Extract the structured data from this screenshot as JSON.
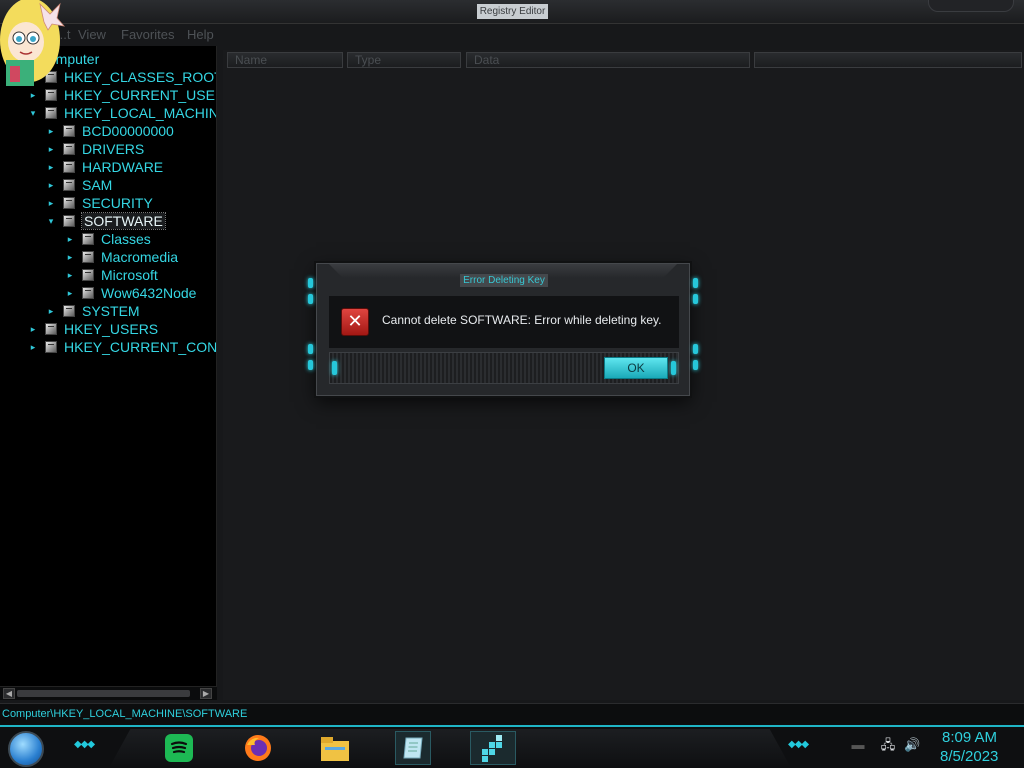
{
  "window": {
    "title": "Registry Editor"
  },
  "menu": {
    "items": [
      "...t",
      "View",
      "Favorites",
      "Help"
    ]
  },
  "tree": {
    "root_label": "...mputer",
    "items": [
      {
        "label": "HKEY_CLASSES_ROOT",
        "level": 1,
        "expanded": false
      },
      {
        "label": "HKEY_CURRENT_USER",
        "level": 1,
        "expanded": false
      },
      {
        "label": "HKEY_LOCAL_MACHINE",
        "level": 1,
        "expanded": true
      },
      {
        "label": "BCD00000000",
        "level": 2,
        "expanded": false
      },
      {
        "label": "DRIVERS",
        "level": 2,
        "expanded": false
      },
      {
        "label": "HARDWARE",
        "level": 2,
        "expanded": false
      },
      {
        "label": "SAM",
        "level": 2,
        "expanded": false
      },
      {
        "label": "SECURITY",
        "level": 2,
        "expanded": false
      },
      {
        "label": "SOFTWARE",
        "level": 2,
        "expanded": true,
        "selected": true
      },
      {
        "label": "Classes",
        "level": 3,
        "expanded": false
      },
      {
        "label": "Macromedia",
        "level": 3,
        "expanded": false
      },
      {
        "label": "Microsoft",
        "level": 3,
        "expanded": false
      },
      {
        "label": "Wow6432Node",
        "level": 3,
        "expanded": false
      },
      {
        "label": "SYSTEM",
        "level": 2,
        "expanded": false
      },
      {
        "label": "HKEY_USERS",
        "level": 1,
        "expanded": false
      },
      {
        "label": "HKEY_CURRENT_CONFI",
        "level": 1,
        "expanded": false
      }
    ]
  },
  "list": {
    "columns": [
      "Name",
      "Type",
      "Data"
    ]
  },
  "status": {
    "path": "Computer\\HKEY_LOCAL_MACHINE\\SOFTWARE"
  },
  "dialog": {
    "title": "Error Deleting Key",
    "message": "Cannot delete SOFTWARE:  Error while deleting key.",
    "ok_label": "OK",
    "icon": "error-x-icon"
  },
  "taskbar": {
    "apps": [
      "spotify-icon",
      "firefox-icon",
      "file-explorer-icon",
      "notepad-icon",
      "registry-editor-icon"
    ],
    "clock_time": "8:09 AM",
    "clock_date": "8/5/2023"
  },
  "colors": {
    "accent": "#2fd0dd",
    "background": "#17181a",
    "error_red": "#c62a24"
  }
}
